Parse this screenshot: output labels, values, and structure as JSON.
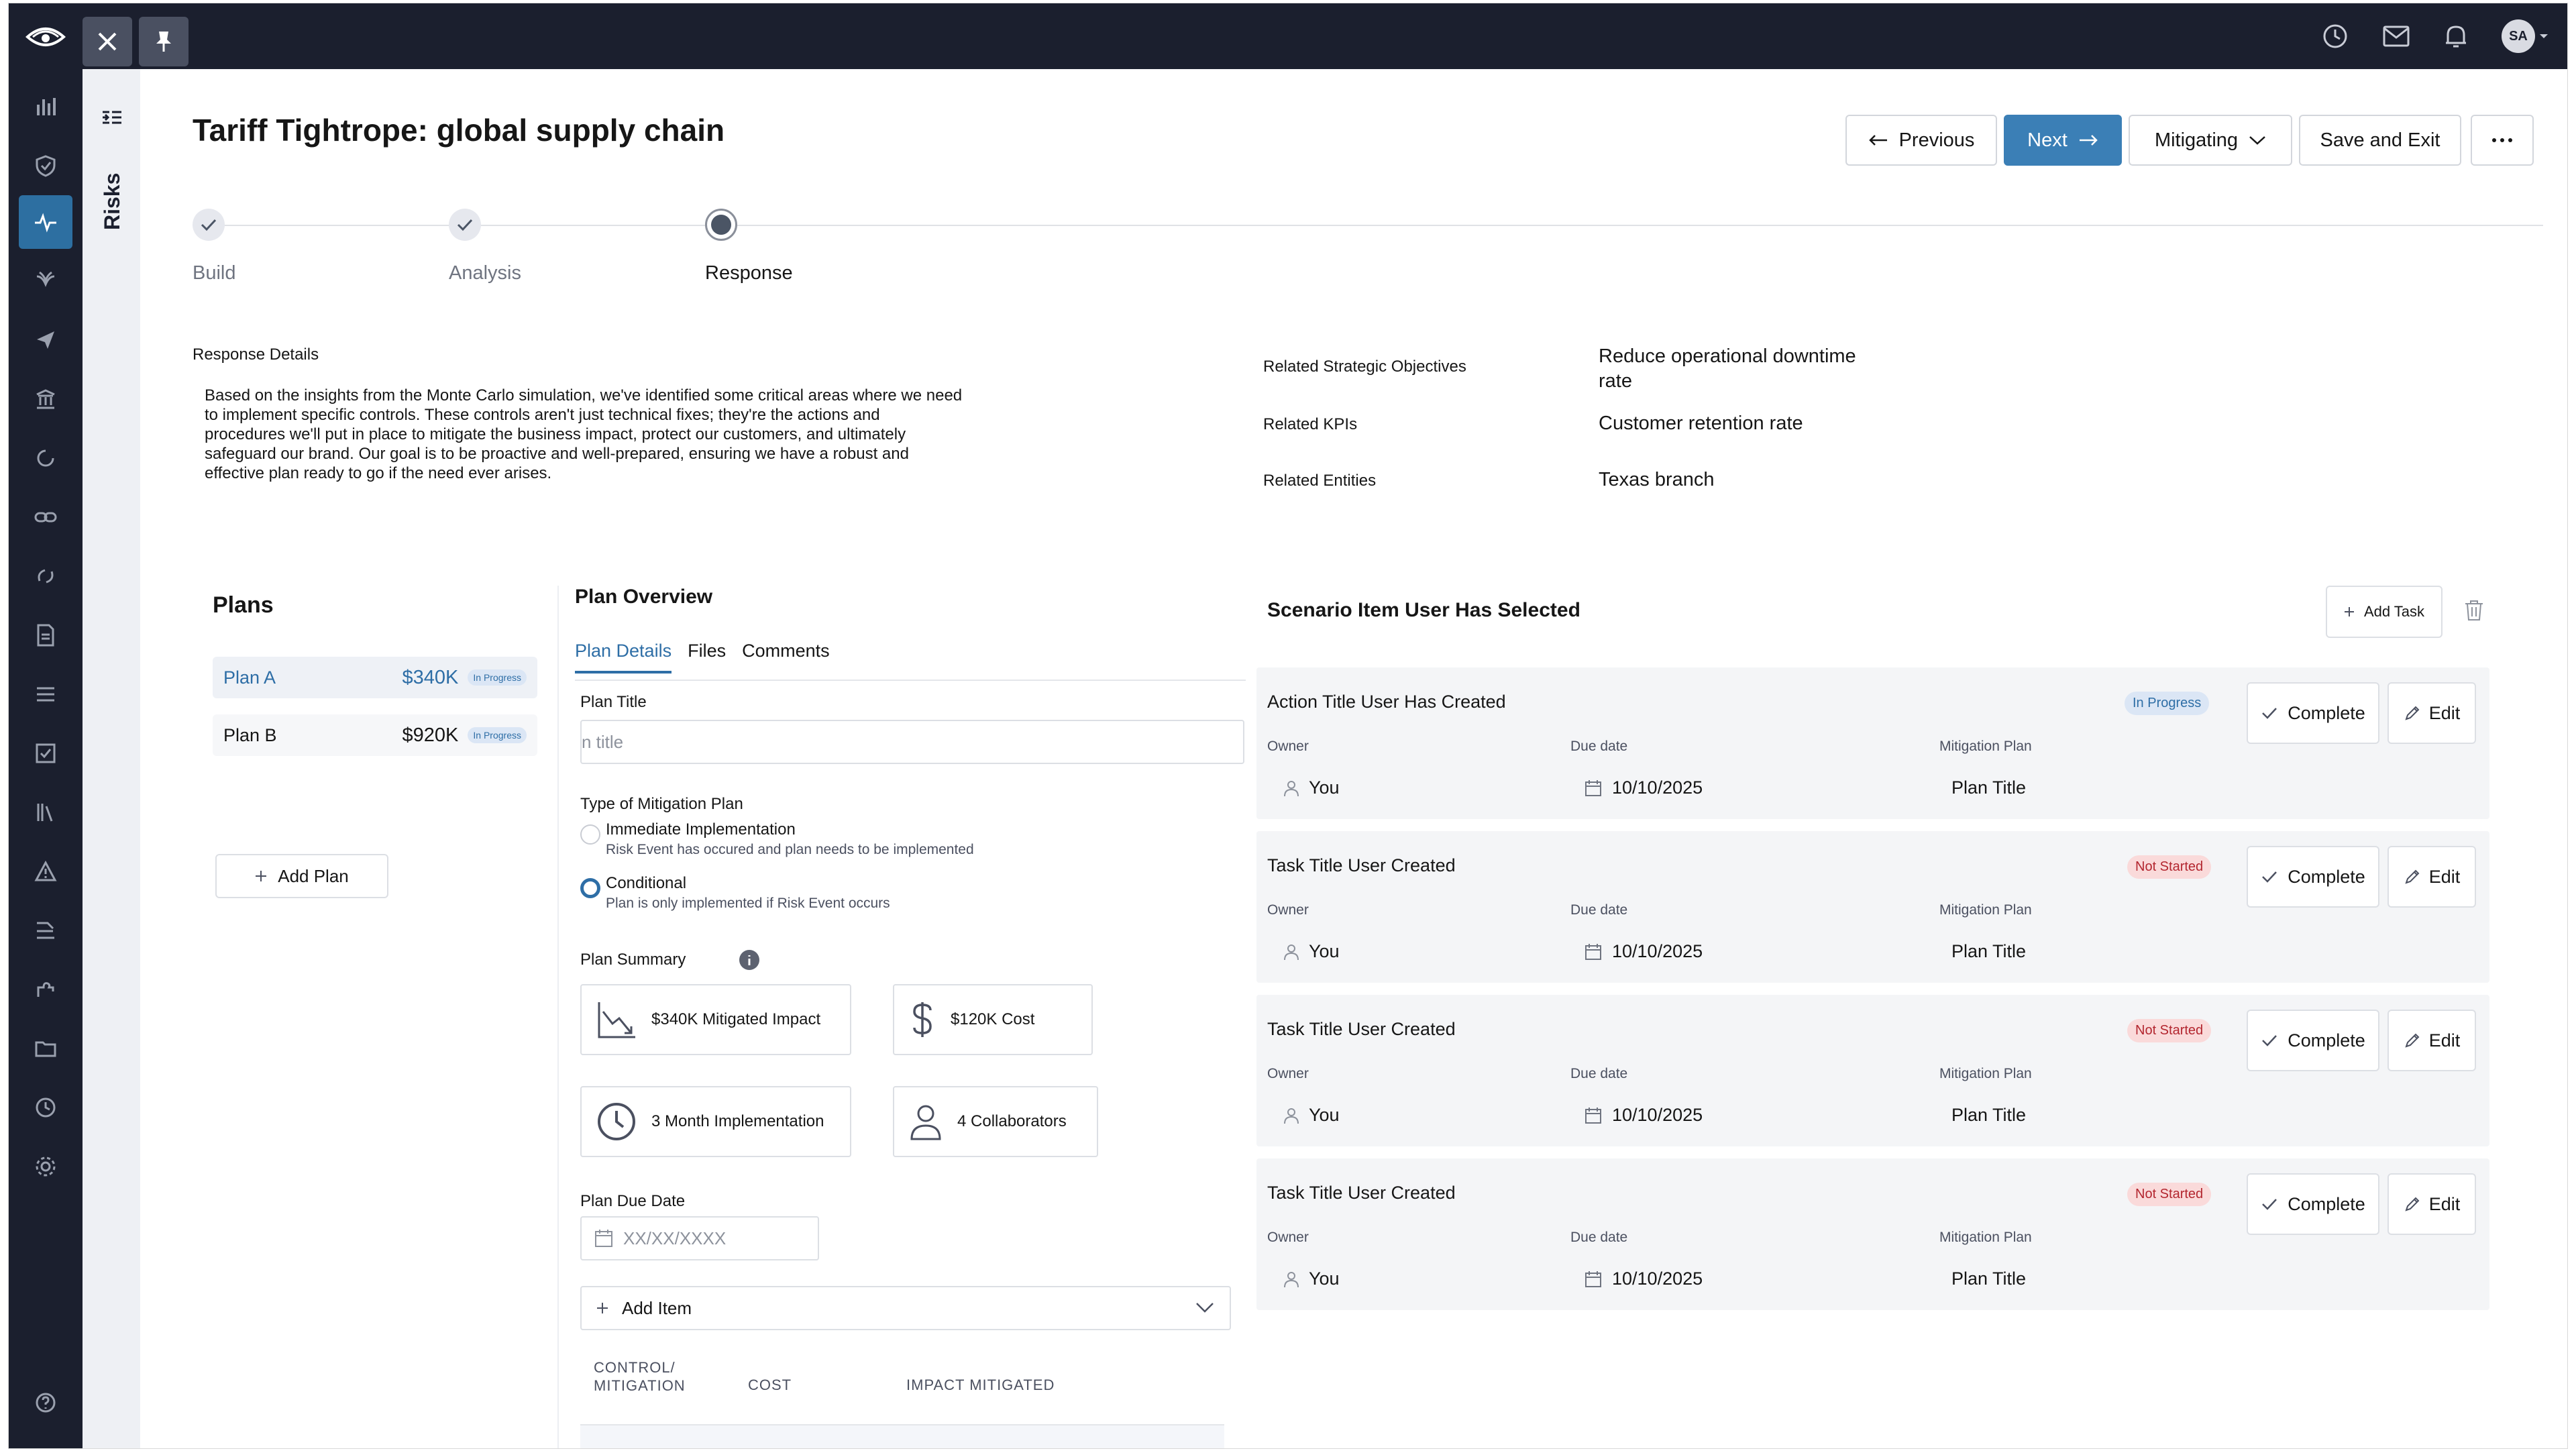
{
  "topbar": {
    "avatar_initials": "SA"
  },
  "strip": {
    "label": "Risks"
  },
  "header": {
    "title": "Tariff Tightrope: global supply chain",
    "previous_label": "Previous",
    "next_label": "Next",
    "status_label": "Mitigating",
    "save_exit_label": "Save and Exit"
  },
  "stepper": {
    "steps": [
      {
        "label": "Build",
        "state": "done"
      },
      {
        "label": "Analysis",
        "state": "done"
      },
      {
        "label": "Response",
        "state": "current"
      }
    ]
  },
  "response": {
    "label": "Response Details",
    "text": "Based on the insights from the Monte Carlo simulation, we've identified some critical areas where we need to implement specific controls. These controls aren't just technical fixes; they're the actions and procedures we'll put in place to mitigate the business impact, protect our customers, and ultimately safeguard our brand. Our goal is to be proactive and well-prepared, ensuring we have a robust and effective plan ready to go if the need ever arises.",
    "related": [
      {
        "label": "Related Strategic Objectives",
        "value": "Reduce operational downtime rate"
      },
      {
        "label": "Related KPIs",
        "value": "Customer retention rate"
      },
      {
        "label": "Related Entities",
        "value": "Texas branch"
      }
    ]
  },
  "plans": {
    "title": "Plans",
    "items": [
      {
        "name": "Plan A",
        "amount": "$340K",
        "status": "In Progress"
      },
      {
        "name": "Plan B",
        "amount": "$920K",
        "status": "In Progress"
      }
    ],
    "add_label": "Add Plan"
  },
  "overview": {
    "title": "Plan Overview",
    "tabs": [
      "Plan Details",
      "Files",
      "Comments"
    ],
    "plan_title_label": "Plan Title",
    "plan_title_placeholder": "n title",
    "type_label": "Type of Mitigation Plan",
    "options": [
      {
        "title": "Immediate Implementation",
        "sub": "Risk Event has occured and plan needs to be implemented"
      },
      {
        "title": "Conditional",
        "sub": "Plan is only implemented if Risk Event occurs"
      }
    ],
    "summary_label": "Plan Summary",
    "summary": [
      "$340K Mitigated Impact",
      "$120K Cost",
      "3 Month Implementation",
      "4 Collaborators"
    ],
    "due_label": "Plan Due Date",
    "due_placeholder": "XX/XX/XXXX",
    "add_item_label": "Add Item",
    "columns": [
      "CONTROL/\nMITIGATION",
      "COST",
      "IMPACT MITIGATED"
    ]
  },
  "scenario": {
    "title": "Scenario Item User Has Selected",
    "add_task_label": "Add Task",
    "col_owner": "Owner",
    "col_due": "Due date",
    "col_plan": "Mitigation Plan",
    "complete_label": "Complete",
    "edit_label": "Edit",
    "tasks": [
      {
        "title": "Action Title User Has Created",
        "status": "In Progress",
        "owner": "You",
        "due": "10/10/2025",
        "plan": "Plan Title"
      },
      {
        "title": "Task Title User Created",
        "status": "Not Started",
        "owner": "You",
        "due": "10/10/2025",
        "plan": "Plan Title"
      },
      {
        "title": "Task Title User Created",
        "status": "Not Started",
        "owner": "You",
        "due": "10/10/2025",
        "plan": "Plan Title"
      },
      {
        "title": "Task Title User Created",
        "status": "Not Started",
        "owner": "You",
        "due": "10/10/2025",
        "plan": "Plan Title"
      }
    ]
  },
  "colors": {
    "accent": "#3b7fb6",
    "nav_bg": "#1b1f2e",
    "not_started": "#b3262f"
  }
}
